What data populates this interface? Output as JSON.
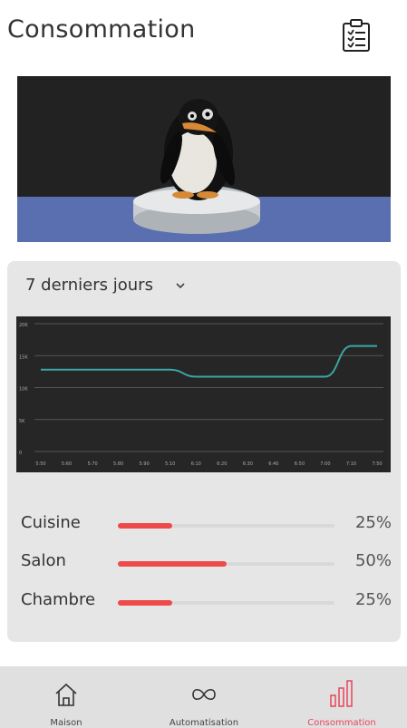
{
  "header": {
    "title": "Consommation",
    "clipboard_icon": "clipboard-list-icon"
  },
  "dropdown": {
    "selected": "7 derniers jours",
    "icon": "chevron-down-icon"
  },
  "chart_data": {
    "type": "line",
    "title": "",
    "y_tick_labels": [
      "20K",
      "15K",
      "10K",
      "5K",
      "0"
    ],
    "x_tick_labels": [
      "5:50",
      "5:60",
      "5:70",
      "5:80",
      "5:90",
      "5:10",
      "6:10",
      "6:20",
      "6:30",
      "6:40",
      "6:50",
      "7:00",
      "7:10",
      "7:50"
    ],
    "series": [
      {
        "color": "#3aa6a6",
        "values": [
          12.8,
          12.8,
          12.8,
          12.8,
          12.8,
          12.8,
          11.7,
          11.7,
          11.7,
          11.7,
          11.7,
          11.7,
          16.5,
          16.5
        ]
      }
    ],
    "ylim": [
      0,
      20
    ],
    "grid": true
  },
  "usage": [
    {
      "label": "Cuisine",
      "fraction": 0.25,
      "percent": "25%"
    },
    {
      "label": "Salon",
      "fraction": 0.5,
      "percent": "50%"
    },
    {
      "label": "Chambre",
      "fraction": 0.25,
      "percent": "25%"
    }
  ],
  "colors": {
    "accent": "#ee4a4a",
    "line": "#3aa6a6",
    "nav_active": "#e8445a"
  },
  "nav": {
    "items": [
      {
        "label": "Maison",
        "icon": "house-icon"
      },
      {
        "label": "Automatisation",
        "icon": "infinity-icon"
      },
      {
        "label": "Consommation",
        "icon": "bar-chart-icon"
      }
    ]
  }
}
